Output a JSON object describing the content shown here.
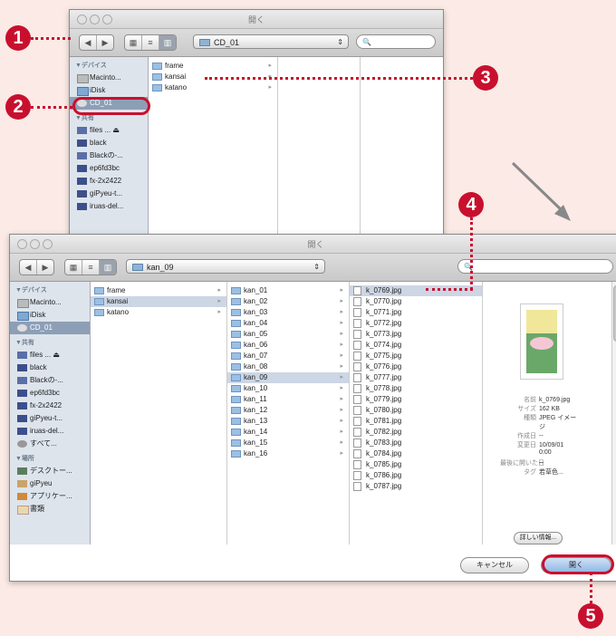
{
  "window1": {
    "title": "開く",
    "location": "CD_01",
    "search_placeholder": "",
    "sidebar": {
      "devices_header": "▼デバイス",
      "devices": [
        "Macinto...",
        "iDisk",
        "CD_01"
      ],
      "shared_header": "▼共有",
      "shared": [
        "files ... ⏏",
        "black",
        "Blackの-...",
        "ep6fd3bc",
        "fx-2x2422",
        "giPyeu-t...",
        "iruas-del..."
      ]
    },
    "column1": [
      "frame",
      "kansai",
      "katano"
    ]
  },
  "window2": {
    "title": "開く",
    "location": "kan_09",
    "search_placeholder": "",
    "sidebar": {
      "devices_header": "▼デバイス",
      "devices": [
        "Macinto...",
        "iDisk",
        "CD_01"
      ],
      "shared_header": "▼共有",
      "shared": [
        "files ... ⏏",
        "black",
        "Blackの-...",
        "ep6fd3bc",
        "fx-2x2422",
        "giPyeu-t...",
        "iruas-del...",
        "すべて..."
      ],
      "places_header": "▼場所",
      "places": [
        "デスクトー...",
        "giPyeu",
        "アプリケー...",
        "書類"
      ]
    },
    "column1": [
      "frame",
      "kansai",
      "katano"
    ],
    "column2": [
      "kan_01",
      "kan_02",
      "kan_03",
      "kan_04",
      "kan_05",
      "kan_06",
      "kan_07",
      "kan_08",
      "kan_09",
      "kan_10",
      "kan_11",
      "kan_12",
      "kan_13",
      "kan_14",
      "kan_15",
      "kan_16"
    ],
    "column3": [
      "k_0769.jpg",
      "k_0770.jpg",
      "k_0771.jpg",
      "k_0772.jpg",
      "k_0773.jpg",
      "k_0774.jpg",
      "k_0775.jpg",
      "k_0776.jpg",
      "k_0777.jpg",
      "k_0778.jpg",
      "k_0779.jpg",
      "k_0780.jpg",
      "k_0781.jpg",
      "k_0782.jpg",
      "k_0783.jpg",
      "k_0784.jpg",
      "k_0785.jpg",
      "k_0786.jpg",
      "k_0787.jpg"
    ],
    "info": [
      {
        "k": "名前",
        "v": "k_0769.jpg"
      },
      {
        "k": "サイズ",
        "v": "162 KB"
      },
      {
        "k": "種類",
        "v": "JPEG イメー"
      },
      {
        "k": "",
        "v": "ジ"
      },
      {
        "k": "作成日",
        "v": "--"
      },
      {
        "k": "変更日",
        "v": "10/09/01"
      },
      {
        "k": "",
        "v": "0:00"
      },
      {
        "k": "最後に開いた日",
        "v": "--"
      },
      {
        "k": "タグ",
        "v": "若草色..."
      }
    ],
    "more_info": "詳しい情報...",
    "cancel": "キャンセル",
    "open": "開く"
  },
  "callouts": [
    "1",
    "2",
    "3",
    "4",
    "5"
  ]
}
